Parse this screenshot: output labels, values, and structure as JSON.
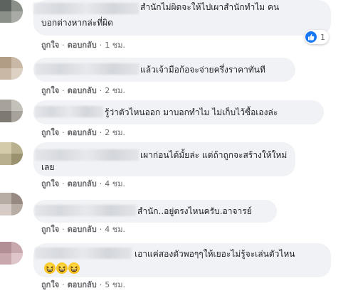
{
  "comments": [
    {
      "lines": [
        "สำนักไม่ผิดจะให้ไปเผาสำนักทำไม คน",
        "บอกต่างหากล่ะที่ผิด"
      ],
      "like": "ถูกใจ",
      "reply": "ตอบกลับ",
      "time": "1 ชม.",
      "reaction": {
        "icon": "like-icon",
        "count": "1"
      }
    },
    {
      "lines": [
        "แล้วเจ้ามือก้อจะจ่ายครึ่งราคาทันที"
      ],
      "like": "ถูกใจ",
      "reply": "ตอบกลับ",
      "time": "2 ชม."
    },
    {
      "lines": [
        "รู้ว่าตัวไหนออก มาบอกทำไม ไม่เก็บไว้ซื้อเองล่ะ"
      ],
      "like": "ถูกใจ",
      "reply": "ตอบกลับ",
      "time": "2 ชม."
    },
    {
      "lines": [
        "เผาก่อนได้มั้ยล่ะ แต่ถ้าถูกจะสร้างให้ใหม่",
        "เลย"
      ],
      "like": "ถูกใจ",
      "reply": "ตอบกลับ",
      "time": "4 ชม."
    },
    {
      "lines": [
        "สำนัก..อยู่ตรงไหนครับ.อาจารย์"
      ],
      "like": "ถูกใจ",
      "reply": "ตอบกลับ",
      "time": "4 ชม."
    },
    {
      "lines": [
        "เอาแค่สองตัวพอๆๆให้เยอะไม่รู้จะเล่นตัวไหน"
      ],
      "emojis": [
        "grinning-squinting-face-emoji",
        "grinning-squinting-face-emoji",
        "grinning-squinting-face-emoji"
      ],
      "like": "ถูกใจ",
      "reply": "ตอบกลับ",
      "time": "5 ชม."
    }
  ],
  "separator": "·",
  "colors": {
    "bubble": "#f0f2f5",
    "text": "#1c1e21",
    "meta": "#65676b",
    "like_blue": "#1877f2"
  }
}
